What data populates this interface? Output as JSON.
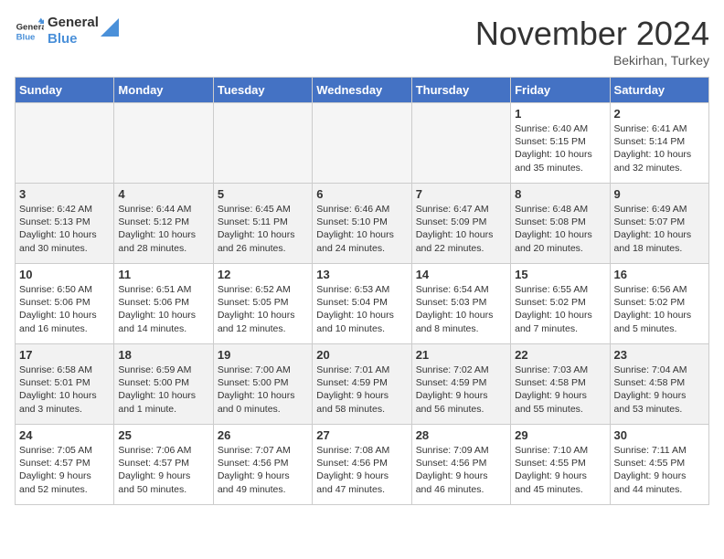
{
  "logo": {
    "line1": "General",
    "line2": "Blue"
  },
  "title": "November 2024",
  "location": "Bekirhan, Turkey",
  "days_of_week": [
    "Sunday",
    "Monday",
    "Tuesday",
    "Wednesday",
    "Thursday",
    "Friday",
    "Saturday"
  ],
  "weeks": [
    [
      {
        "day": "",
        "info": ""
      },
      {
        "day": "",
        "info": ""
      },
      {
        "day": "",
        "info": ""
      },
      {
        "day": "",
        "info": ""
      },
      {
        "day": "",
        "info": ""
      },
      {
        "day": "1",
        "info": "Sunrise: 6:40 AM\nSunset: 5:15 PM\nDaylight: 10 hours\nand 35 minutes."
      },
      {
        "day": "2",
        "info": "Sunrise: 6:41 AM\nSunset: 5:14 PM\nDaylight: 10 hours\nand 32 minutes."
      }
    ],
    [
      {
        "day": "3",
        "info": "Sunrise: 6:42 AM\nSunset: 5:13 PM\nDaylight: 10 hours\nand 30 minutes."
      },
      {
        "day": "4",
        "info": "Sunrise: 6:44 AM\nSunset: 5:12 PM\nDaylight: 10 hours\nand 28 minutes."
      },
      {
        "day": "5",
        "info": "Sunrise: 6:45 AM\nSunset: 5:11 PM\nDaylight: 10 hours\nand 26 minutes."
      },
      {
        "day": "6",
        "info": "Sunrise: 6:46 AM\nSunset: 5:10 PM\nDaylight: 10 hours\nand 24 minutes."
      },
      {
        "day": "7",
        "info": "Sunrise: 6:47 AM\nSunset: 5:09 PM\nDaylight: 10 hours\nand 22 minutes."
      },
      {
        "day": "8",
        "info": "Sunrise: 6:48 AM\nSunset: 5:08 PM\nDaylight: 10 hours\nand 20 minutes."
      },
      {
        "day": "9",
        "info": "Sunrise: 6:49 AM\nSunset: 5:07 PM\nDaylight: 10 hours\nand 18 minutes."
      }
    ],
    [
      {
        "day": "10",
        "info": "Sunrise: 6:50 AM\nSunset: 5:06 PM\nDaylight: 10 hours\nand 16 minutes."
      },
      {
        "day": "11",
        "info": "Sunrise: 6:51 AM\nSunset: 5:06 PM\nDaylight: 10 hours\nand 14 minutes."
      },
      {
        "day": "12",
        "info": "Sunrise: 6:52 AM\nSunset: 5:05 PM\nDaylight: 10 hours\nand 12 minutes."
      },
      {
        "day": "13",
        "info": "Sunrise: 6:53 AM\nSunset: 5:04 PM\nDaylight: 10 hours\nand 10 minutes."
      },
      {
        "day": "14",
        "info": "Sunrise: 6:54 AM\nSunset: 5:03 PM\nDaylight: 10 hours\nand 8 minutes."
      },
      {
        "day": "15",
        "info": "Sunrise: 6:55 AM\nSunset: 5:02 PM\nDaylight: 10 hours\nand 7 minutes."
      },
      {
        "day": "16",
        "info": "Sunrise: 6:56 AM\nSunset: 5:02 PM\nDaylight: 10 hours\nand 5 minutes."
      }
    ],
    [
      {
        "day": "17",
        "info": "Sunrise: 6:58 AM\nSunset: 5:01 PM\nDaylight: 10 hours\nand 3 minutes."
      },
      {
        "day": "18",
        "info": "Sunrise: 6:59 AM\nSunset: 5:00 PM\nDaylight: 10 hours\nand 1 minute."
      },
      {
        "day": "19",
        "info": "Sunrise: 7:00 AM\nSunset: 5:00 PM\nDaylight: 10 hours\nand 0 minutes."
      },
      {
        "day": "20",
        "info": "Sunrise: 7:01 AM\nSunset: 4:59 PM\nDaylight: 9 hours\nand 58 minutes."
      },
      {
        "day": "21",
        "info": "Sunrise: 7:02 AM\nSunset: 4:59 PM\nDaylight: 9 hours\nand 56 minutes."
      },
      {
        "day": "22",
        "info": "Sunrise: 7:03 AM\nSunset: 4:58 PM\nDaylight: 9 hours\nand 55 minutes."
      },
      {
        "day": "23",
        "info": "Sunrise: 7:04 AM\nSunset: 4:58 PM\nDaylight: 9 hours\nand 53 minutes."
      }
    ],
    [
      {
        "day": "24",
        "info": "Sunrise: 7:05 AM\nSunset: 4:57 PM\nDaylight: 9 hours\nand 52 minutes."
      },
      {
        "day": "25",
        "info": "Sunrise: 7:06 AM\nSunset: 4:57 PM\nDaylight: 9 hours\nand 50 minutes."
      },
      {
        "day": "26",
        "info": "Sunrise: 7:07 AM\nSunset: 4:56 PM\nDaylight: 9 hours\nand 49 minutes."
      },
      {
        "day": "27",
        "info": "Sunrise: 7:08 AM\nSunset: 4:56 PM\nDaylight: 9 hours\nand 47 minutes."
      },
      {
        "day": "28",
        "info": "Sunrise: 7:09 AM\nSunset: 4:56 PM\nDaylight: 9 hours\nand 46 minutes."
      },
      {
        "day": "29",
        "info": "Sunrise: 7:10 AM\nSunset: 4:55 PM\nDaylight: 9 hours\nand 45 minutes."
      },
      {
        "day": "30",
        "info": "Sunrise: 7:11 AM\nSunset: 4:55 PM\nDaylight: 9 hours\nand 44 minutes."
      }
    ]
  ]
}
